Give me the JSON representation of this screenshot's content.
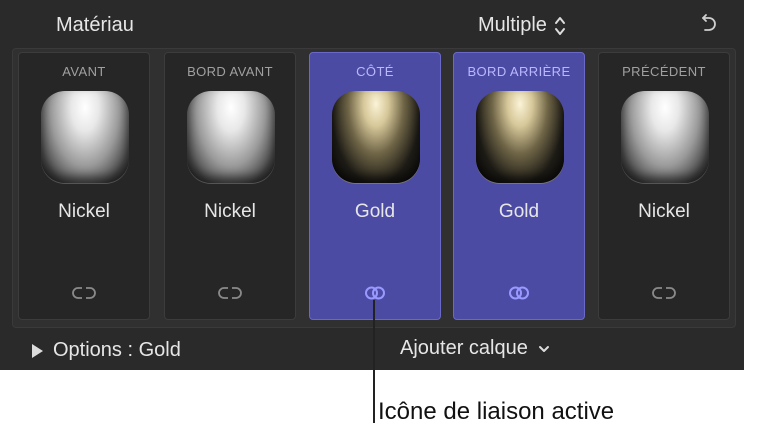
{
  "header": {
    "title": "Matériau",
    "dropdown_value": "Multiple",
    "reset_icon": "reset-icon"
  },
  "tiles": [
    {
      "label": "AVANT",
      "material": "Nickel",
      "linked": false
    },
    {
      "label": "BORD AVANT",
      "material": "Nickel",
      "linked": false
    },
    {
      "label": "CÔTÉ",
      "material": "Gold",
      "linked": true
    },
    {
      "label": "BORD ARRIÈRE",
      "material": "Gold",
      "linked": true
    },
    {
      "label": "PRÉCÉDENT",
      "material": "Nickel",
      "linked": false
    }
  ],
  "footer": {
    "options_label": "Options : Gold",
    "add_layer_label": "Ajouter calque"
  },
  "callout": {
    "text": "Icône de liaison active"
  },
  "colors": {
    "panel_bg": "#2a2a2a",
    "active_tile": "#4c4ba3",
    "active_label": "#b9b8ff",
    "link_active": "#9a99ff",
    "link_inactive": "#8a8a8a"
  }
}
